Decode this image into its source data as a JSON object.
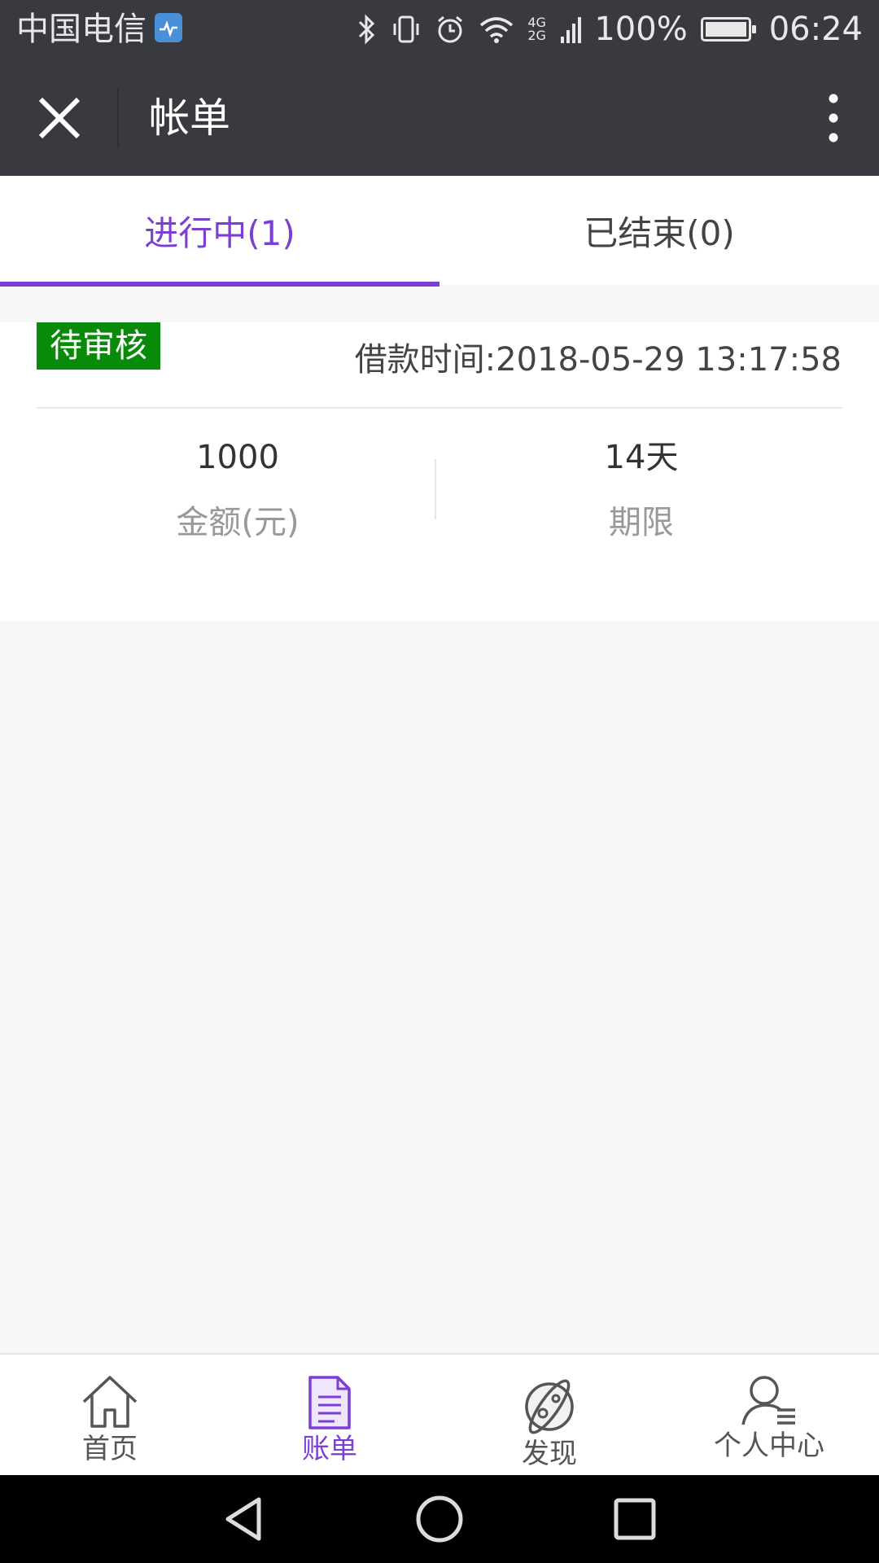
{
  "status_bar": {
    "carrier": "中国电信",
    "network": "4G 2G",
    "battery": "100%",
    "battery_level": 1.0,
    "time": "06:24"
  },
  "title_bar": {
    "title": "帐单"
  },
  "tabs": [
    {
      "label": "进行中(1)",
      "active": true
    },
    {
      "label": "已结束(0)",
      "active": false
    }
  ],
  "bill": {
    "status": "待审核",
    "status_color": "#0a8a0a",
    "loan_time": "借款时间:2018-05-29 13:17:58",
    "amount_value": "1000",
    "amount_label": "金额(元)",
    "term_value": "14天",
    "term_label": "期限"
  },
  "bottom_nav": [
    {
      "label": "首页",
      "icon": "home-icon",
      "active": false
    },
    {
      "label": "账单",
      "icon": "bill-icon",
      "active": true
    },
    {
      "label": "发现",
      "icon": "planet-icon",
      "active": false
    },
    {
      "label": "个人中心",
      "icon": "user-icon",
      "active": false
    }
  ],
  "colors": {
    "accent": "#7b3fd4",
    "header_bg": "#393a3f"
  }
}
